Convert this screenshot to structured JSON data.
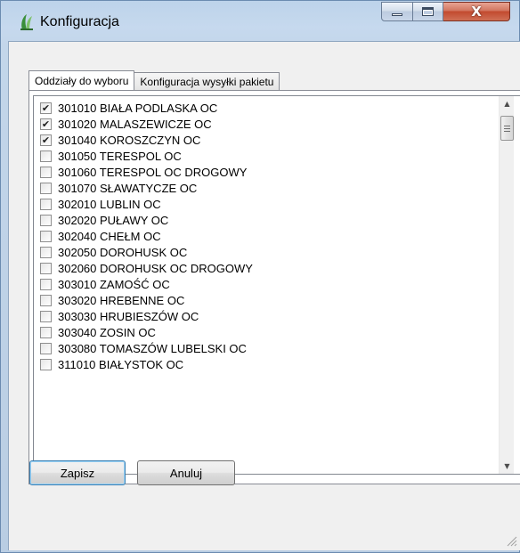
{
  "window": {
    "title": "Konfiguracja",
    "icon": "app-logo-icon",
    "caption_buttons": [
      {
        "name": "minimize",
        "icon": "minimize-icon"
      },
      {
        "name": "maximize",
        "icon": "maximize-icon"
      },
      {
        "name": "close",
        "icon": "close-icon",
        "glyph": "X"
      }
    ]
  },
  "tabs": [
    {
      "label": "Oddziały do wyboru",
      "active": true
    },
    {
      "label": "Konfiguracja wysyłki pakietu",
      "active": false
    }
  ],
  "list": {
    "items": [
      {
        "label": "301010 BIAŁA PODLASKA OC",
        "checked": true
      },
      {
        "label": "301020 MALASZEWICZE OC",
        "checked": true
      },
      {
        "label": "301040 KOROSZCZYN OC",
        "checked": true
      },
      {
        "label": "301050 TERESPOL OC",
        "checked": false
      },
      {
        "label": "301060 TERESPOL OC DROGOWY",
        "checked": false
      },
      {
        "label": "301070 SŁAWATYCZE OC",
        "checked": false
      },
      {
        "label": "302010 LUBLIN OC",
        "checked": false
      },
      {
        "label": "302020 PUŁAWY OC",
        "checked": false
      },
      {
        "label": "302040 CHEŁM OC",
        "checked": false
      },
      {
        "label": "302050 DOROHUSK OC",
        "checked": false
      },
      {
        "label": "302060 DOROHUSK OC DROGOWY",
        "checked": false
      },
      {
        "label": "303010 ZAMOŚĆ OC",
        "checked": false
      },
      {
        "label": "303020 HREBENNE OC",
        "checked": false
      },
      {
        "label": "303030 HRUBIESZÓW OC",
        "checked": false
      },
      {
        "label": "303040 ZOSIN OC",
        "checked": false
      },
      {
        "label": "303080 TOMASZÓW LUBELSKI OC",
        "checked": false
      },
      {
        "label": "311010 BIAŁYSTOK OC",
        "checked": false
      }
    ],
    "check_glyph": "✔"
  },
  "buttons": {
    "save_label": "Zapisz",
    "cancel_label": "Anuluj"
  },
  "colors": {
    "close_button": "#c24a2f",
    "title_bar": "#c6d9ee",
    "default_button_border": "#3c7fb1"
  }
}
